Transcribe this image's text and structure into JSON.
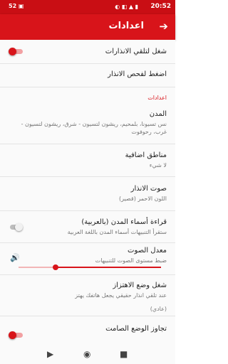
{
  "status_bar": {
    "time": "20:52",
    "left_text": "52 ▣",
    "icons": "◐ ◧ ▲ ▮"
  },
  "app_bar": {
    "title": "اعدادات",
    "back_icon": "arrow-forward-icon"
  },
  "settings": {
    "enable_alerts": {
      "title": "شغل لتلقي الانذارات",
      "checked": true
    },
    "test_alert": {
      "title": "اضغط لفحص الانذار"
    },
    "section_header": "اعدادات",
    "cities": {
      "title": "المدن",
      "summary": "نس تسيونا، بلمحيم، ريشون لتسيون - شرق، ريشون لتسيون - غرب، رحوفوت"
    },
    "additional_areas": {
      "title": "مناطق اضافية",
      "summary": "لا شيء"
    },
    "alert_sound": {
      "title": "صوت الانذار",
      "summary": "اللون الاحمر (قصير)"
    },
    "read_city_names": {
      "title": "قراءة أسماء المدن (بالعربية)",
      "summary": "ستقرأ التنبيهات أسماء المدن باللغة العربية",
      "checked": false
    },
    "volume": {
      "title": "معدل الصوت",
      "summary": "ضبط مستوى الصوت للتنبيهات",
      "level": 0.74,
      "icon": "volume-up-icon"
    },
    "vibrate": {
      "title": "شغل وضع الاهتزاز",
      "summary": "عند تلقي انذار حقيقي يجعل هاتفك يهتز",
      "value": "(عادي)"
    },
    "override_silent": {
      "title": "تجاوز الوضع الصامت",
      "checked": true
    }
  },
  "nav_bar": {
    "back": "▶",
    "home": "◉",
    "recents": "■"
  },
  "colors": {
    "primary": "#d8141a",
    "status_bar": "#c90e14"
  }
}
